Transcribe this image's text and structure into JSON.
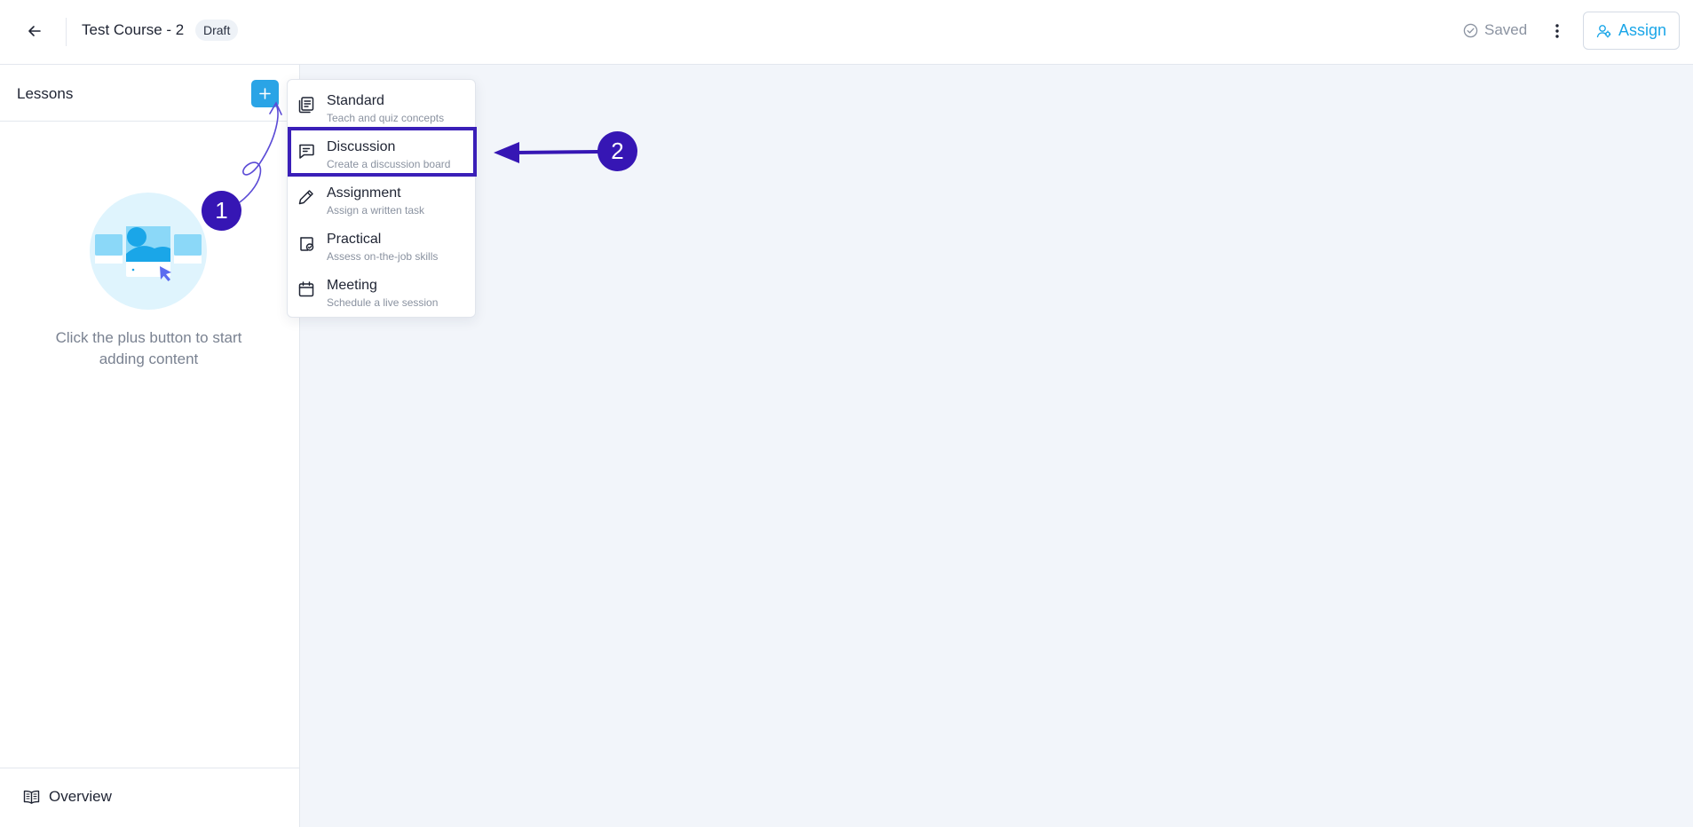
{
  "header": {
    "course_title": "Test Course - 2",
    "status_badge": "Draft",
    "saved_label": "Saved",
    "assign_label": "Assign"
  },
  "sidebar": {
    "title": "Lessons",
    "empty_text": "Click the plus button to start adding content",
    "footer_label": "Overview"
  },
  "add_menu": {
    "items": [
      {
        "label": "Standard",
        "description": "Teach and quiz concepts",
        "icon": "pages-icon"
      },
      {
        "label": "Discussion",
        "description": "Create a discussion board",
        "icon": "chat-icon"
      },
      {
        "label": "Assignment",
        "description": "Assign a written task",
        "icon": "pencil-icon"
      },
      {
        "label": "Practical",
        "description": "Assess on-the-job skills",
        "icon": "clipboard-check-icon"
      },
      {
        "label": "Meeting",
        "description": "Schedule a live session",
        "icon": "calendar-icon"
      }
    ],
    "highlighted_item": "Discussion"
  },
  "annotations": {
    "step_1": "1",
    "step_2": "2"
  },
  "colors": {
    "accent": "#2aa4e6",
    "annotation": "#3616b4",
    "background": "#f2f5fa"
  }
}
